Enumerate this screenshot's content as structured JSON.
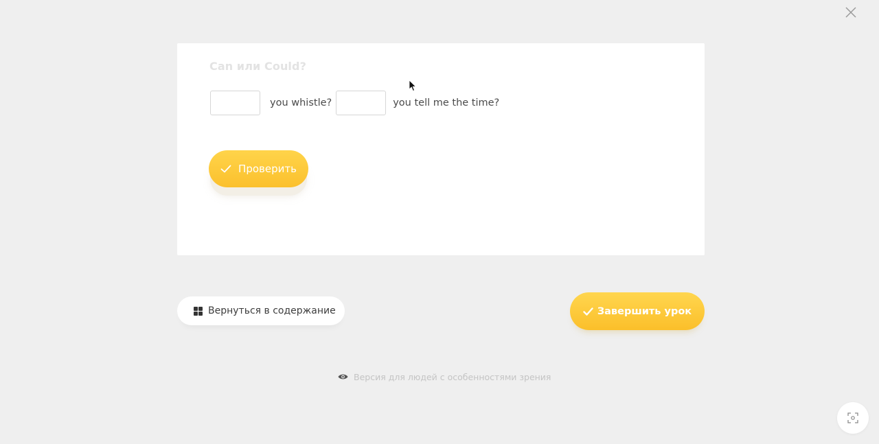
{
  "exercise": {
    "title": "Can или Could?",
    "segment_1": "you whistle?",
    "segment_2": "you tell me the time?",
    "blank_1_value": "",
    "blank_2_value": "",
    "check_label": "Проверить"
  },
  "footer": {
    "back_label": "Вернуться в содержание",
    "finish_label": "Завершить урок",
    "accessibility_label": "Версия для людей с особенностями зрения"
  },
  "colors": {
    "accent_yellow": "#fbc02d",
    "background": "#efefef",
    "card": "#ffffff"
  },
  "icons": {
    "close": "close-icon",
    "check": "check-icon",
    "grid": "grid-icon",
    "eye": "eye-icon",
    "cursor": "cursor-icon",
    "fab": "expand-icon"
  }
}
